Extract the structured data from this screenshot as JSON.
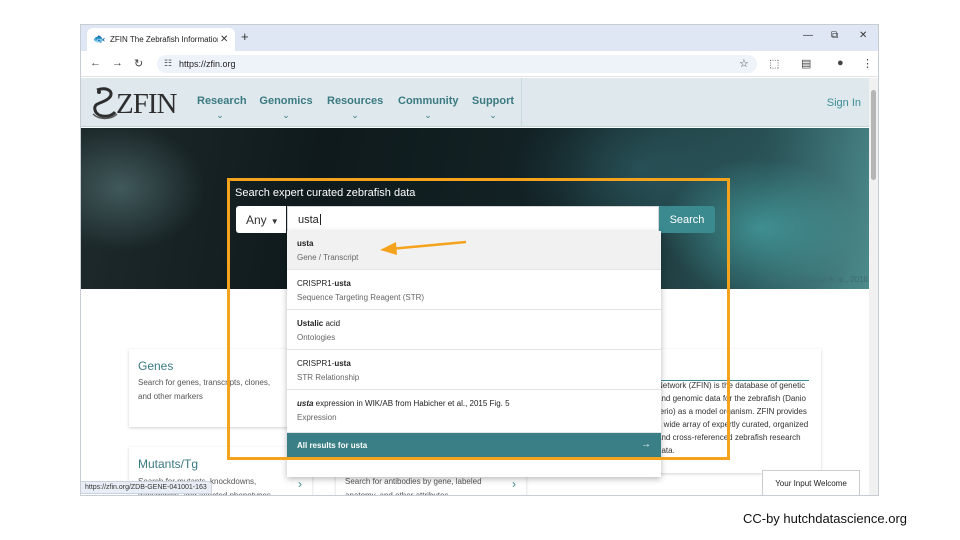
{
  "browser": {
    "tab_title": "ZFIN The Zebrafish Information",
    "new_tab": "+",
    "url": "https://zfin.org",
    "status_url": "https://zfin.org/ZDB-GENE-041001-163"
  },
  "site": {
    "logo_text": "ZFIN",
    "menu": [
      "Research",
      "Genomics",
      "Resources",
      "Community",
      "Support"
    ],
    "sign_in": "Sign In",
    "hero_caption": "Fig. 1 of Monroe et al., 2016"
  },
  "search": {
    "title": "Search expert curated zebrafish data",
    "category": "Any",
    "query": "usta",
    "button": "Search"
  },
  "suggestions": [
    {
      "pre": "",
      "bold": "usta",
      "post": "",
      "sub": "Gene / Transcript"
    },
    {
      "pre": "CRISPR1-",
      "bold": "usta",
      "post": "",
      "sub": "Sequence Targeting Reagent (STR)"
    },
    {
      "pre": "",
      "bold": "Ustalic",
      "post": " acid",
      "sub": "Ontologies"
    },
    {
      "pre": "CRISPR1-",
      "bold": "usta",
      "post": "",
      "sub": "STR Relationship"
    },
    {
      "pre": "",
      "bold": "usta",
      "post": " expression in WIK/AB from Habicher et al., 2015 Fig. 5",
      "sub": "Expression"
    }
  ],
  "all_results": "All results for usta",
  "cards": {
    "genes_title": "Genes",
    "genes_text": "Search for genes, transcripts, clones, and other markers",
    "mutants_title": "Mutants/Tg",
    "mutants_text": "Search for mutants, knockdowns, transgenics, and affected phenotypes",
    "antibodies_text": "Search for antibodies by gene, labeled anatomy, and other attributes",
    "about_text": "Network (ZFIN) is the database of genetic and genomic data for the zebrafish (Danio rerio) as a model organism. ZFIN provides a wide array of expertly curated, organized and cross-referenced zebrafish research data."
  },
  "feedback": "Your Input Welcome",
  "credit": "CC-by hutchdatascience.org",
  "colors": {
    "highlight": "#f5a21c",
    "teal": "#3a8a8f"
  }
}
